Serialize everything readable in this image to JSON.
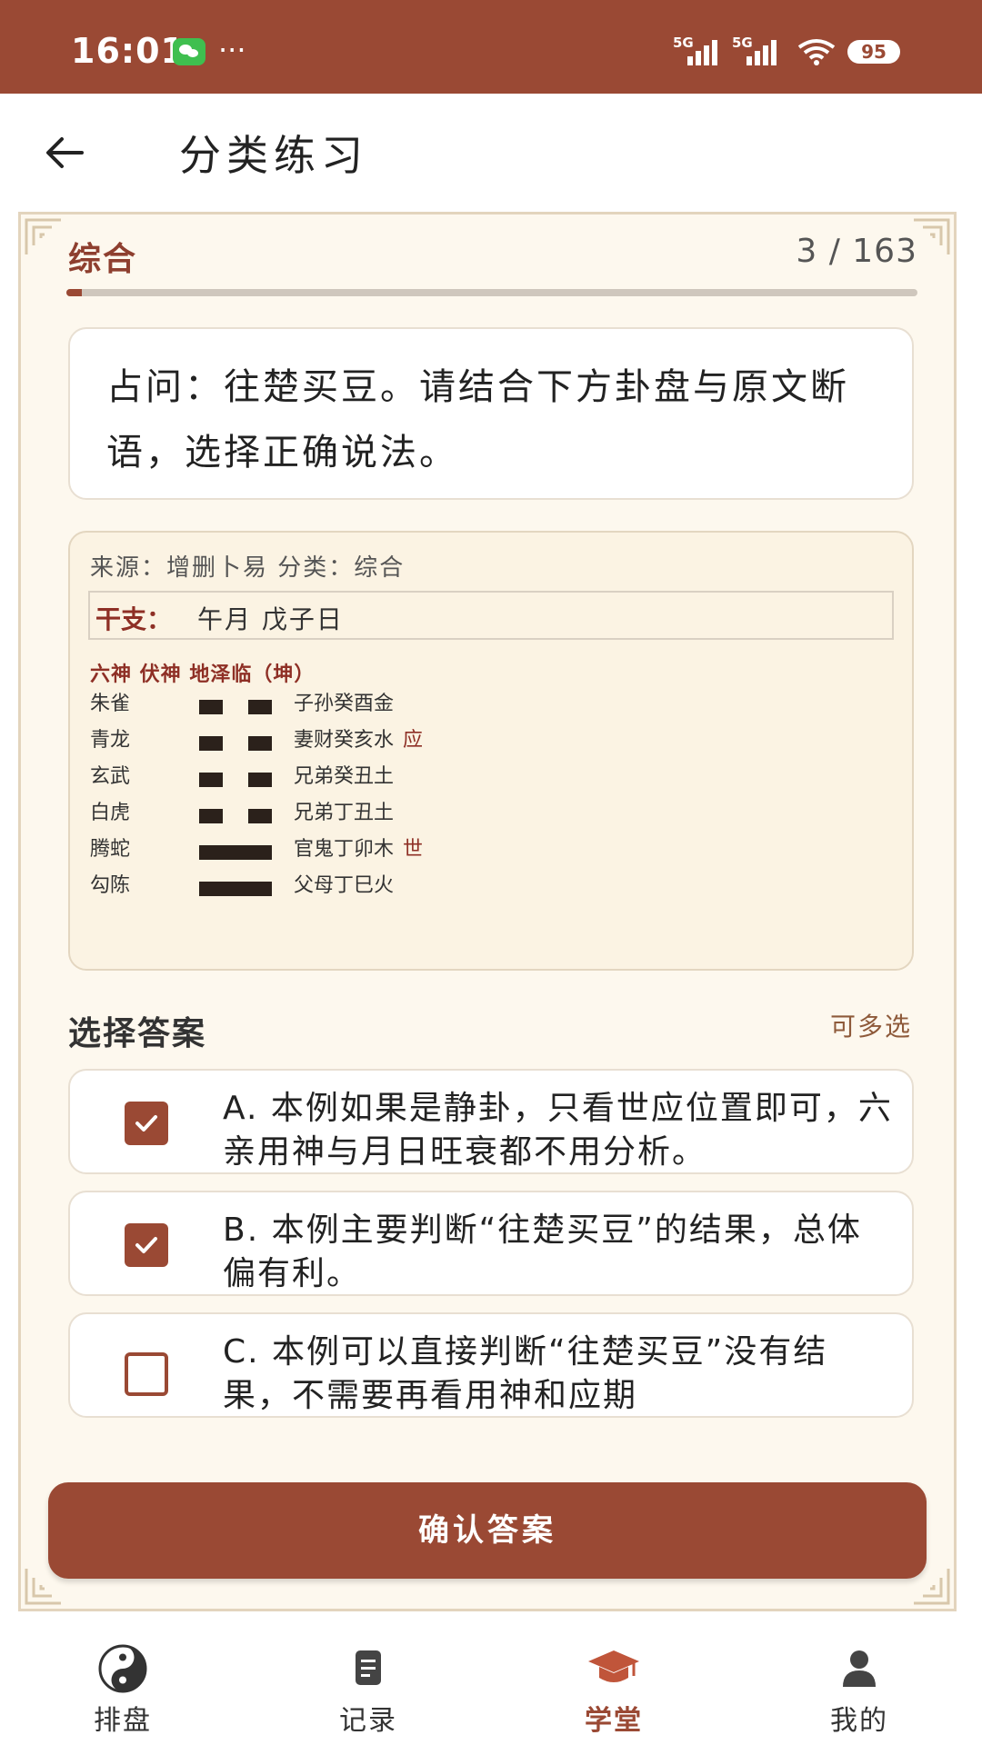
{
  "status_bar": {
    "time": "16:01",
    "more": "···",
    "signal_1": "5G",
    "signal_2": "5G",
    "battery": "95",
    "icons": [
      "wechat-icon",
      "signal-icon",
      "signal-icon",
      "wifi-icon",
      "battery-icon"
    ]
  },
  "header": {
    "title": "分类练习",
    "back_icon": "arrow-left-icon"
  },
  "quiz": {
    "category": "综合",
    "progress_text": "3 / 163",
    "progress_fraction": 0.018,
    "question": "占问：往楚买豆。请结合下方卦盘与原文断语，选择正确说法。"
  },
  "hexagram": {
    "source_line": "来源：增删卜易  分类：综合",
    "ganzhi_label": "干支：",
    "ganzhi_value": "午月 戊子日",
    "header": "六神 伏神 地泽临（坤）",
    "lines": [
      {
        "god": "朱雀",
        "type": "yin",
        "relation": "子孙癸酉金",
        "mark": ""
      },
      {
        "god": "青龙",
        "type": "yin",
        "relation": "妻财癸亥水",
        "mark": "应"
      },
      {
        "god": "玄武",
        "type": "yin",
        "relation": "兄弟癸丑土",
        "mark": ""
      },
      {
        "god": "白虎",
        "type": "yin",
        "relation": "兄弟丁丑土",
        "mark": ""
      },
      {
        "god": "腾蛇",
        "type": "yang",
        "relation": "官鬼丁卯木",
        "mark": "世"
      },
      {
        "god": "勾陈",
        "type": "yang",
        "relation": "父母丁巳火",
        "mark": ""
      }
    ]
  },
  "answers": {
    "title": "选择答案",
    "multi_label": "可多选",
    "options": [
      {
        "text": "A. 本例如果是静卦，只看世应位置即可，六亲用神与月日旺衰都不用分析。",
        "checked": true
      },
      {
        "text": "B. 本例主要判断“往楚买豆”的结果，总体偏有利。",
        "checked": true
      },
      {
        "text": "C. 本例可以直接判断“往楚买豆”没有结果，不需要再看用神和应期",
        "checked": false
      }
    ],
    "confirm_label": "确认答案"
  },
  "bottom_nav": {
    "items": [
      {
        "label": "排盘",
        "icon": "taiji-icon",
        "active": false
      },
      {
        "label": "记录",
        "icon": "document-icon",
        "active": false
      },
      {
        "label": "学堂",
        "icon": "graduation-cap-icon",
        "active": true
      },
      {
        "label": "我的",
        "icon": "person-icon",
        "active": false
      }
    ]
  },
  "colors": {
    "brand": "#9a4934",
    "accent_red": "#8e2f25",
    "frame_bg": "#fdf8ee"
  }
}
